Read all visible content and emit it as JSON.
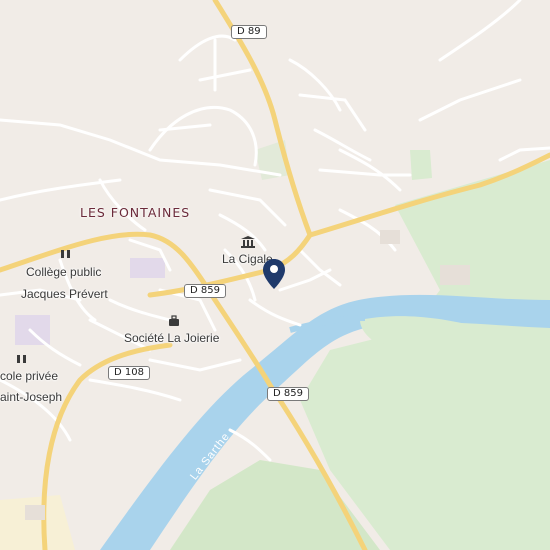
{
  "map": {
    "town_label": "LES FONTAINES",
    "river_label": "La Sarthe",
    "road_labels": {
      "d89": "D 89",
      "d859_a": "D 859",
      "d859_b": "D 859",
      "d108": "D 108"
    },
    "places": {
      "college_l1": "Collège public",
      "college_l2": "Jacques Prévert",
      "la_cigale": "La Cigale",
      "societe": "Société La Joierie",
      "ecole_l1": "cole privée",
      "ecole_l2": "aint-Joseph"
    },
    "colors": {
      "background": "#f1ece7",
      "water": "#a9d3ec",
      "park": "#d9ebd0",
      "main_road": "#f4d37a",
      "minor_road": "#ffffff",
      "marker": "#1f3a6b"
    },
    "icons": {
      "school": "school-icon",
      "museum": "museum-icon",
      "company": "company-icon",
      "marker": "location-pin-icon"
    }
  }
}
